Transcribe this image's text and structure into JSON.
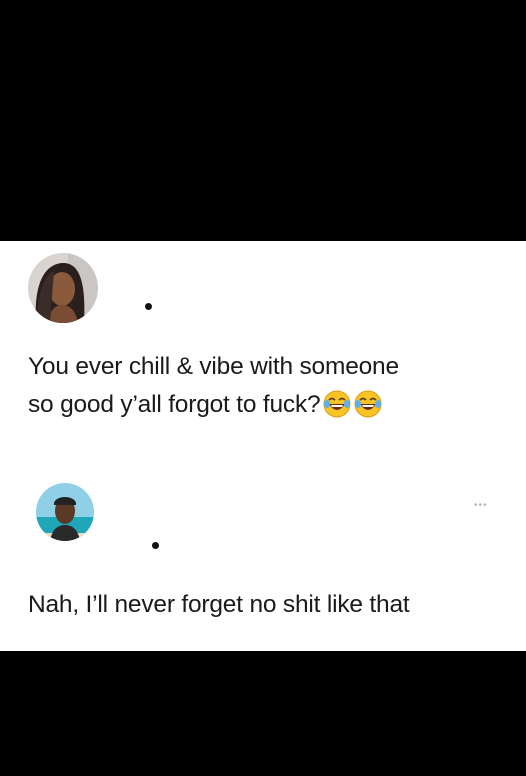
{
  "post": {
    "text_line1": "You ever chill & vibe with someone",
    "text_line2": "so good y’all forgot to fuck?",
    "emojis": [
      "face-with-tears-of-joy",
      "face-with-tears-of-joy"
    ]
  },
  "reply": {
    "text": "Nah, I’ll never forget no shit like that"
  },
  "icons": {
    "more": "ellipsis-icon"
  },
  "colors": {
    "background": "#000000",
    "card": "#ffffff",
    "text": "#1a1a1a",
    "emoji_face": "#f7c325"
  }
}
